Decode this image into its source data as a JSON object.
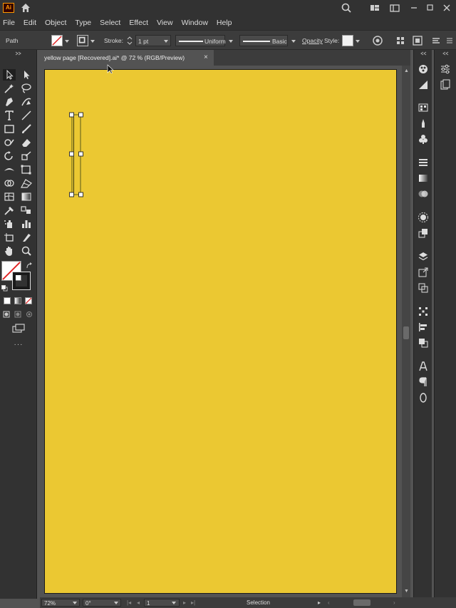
{
  "app": {
    "logo_text": "Ai",
    "colors": {
      "artboard": "#ebc832",
      "ui_dark": "#323232",
      "ui_mid": "#535353",
      "accent": "#ff9a00"
    }
  },
  "titlebar": {
    "icons": [
      "home-icon",
      "search-icon",
      "arrange-documents-icon",
      "workspace-icon",
      "minimize-icon",
      "restore-icon",
      "close-icon"
    ]
  },
  "menu": {
    "items": [
      "File",
      "Edit",
      "Object",
      "Type",
      "Select",
      "Effect",
      "View",
      "Window",
      "Help"
    ]
  },
  "control": {
    "object_type": "Path",
    "stroke_label": "Stroke:",
    "stroke_weight": "1 pt",
    "variable_width": "Uniform",
    "brush": "Basic",
    "opacity_label": "Opacity",
    "style_label": "Style:"
  },
  "document": {
    "tab_title": "yellow page [Recovered].ai* @ 72 % (RGB/Preview)",
    "close_glyph": "×"
  },
  "toolbar": {
    "more_glyph": "···"
  },
  "status": {
    "zoom": "72%",
    "rotation": "0°",
    "artboard": "1",
    "tool": "Selection"
  }
}
